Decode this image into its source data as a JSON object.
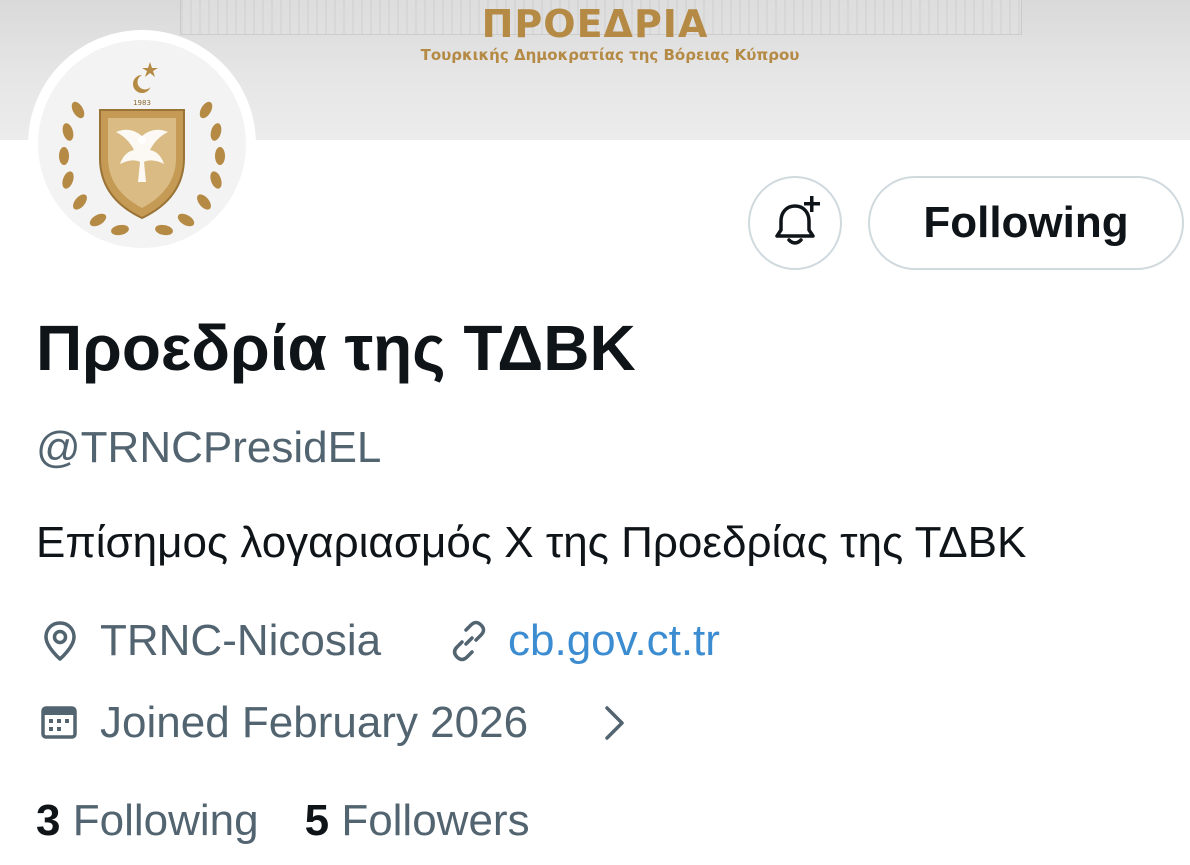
{
  "banner": {
    "title": "ΠΡΟΕΔΡΙΑ",
    "subtitle": "Τουρκικής Δημοκρατίας της Βόρειας Κύπρου"
  },
  "profile": {
    "display_name": "Προεδρία της ΤΔΒΚ",
    "handle": "@TRNCPresidEL",
    "bio": "Επίσημος λογαριασμός X της Προεδρίας της ΤΔΒΚ",
    "location": "TRNC-Nicosia",
    "website": "cb.gov.ct.tr",
    "joined": "Joined February 2026"
  },
  "actions": {
    "following_label": "Following",
    "notify_icon": "bell-plus-icon"
  },
  "stats": {
    "following_count": "3",
    "following_label": "Following",
    "followers_count": "5",
    "followers_label": "Followers"
  },
  "icons": {
    "location": "location-pin-icon",
    "link": "link-icon",
    "calendar": "calendar-icon",
    "chevron": "chevron-right-icon"
  },
  "colors": {
    "gold": "#b58a44",
    "text": "#0f1419",
    "muted": "#536471",
    "link": "#3b8cd1",
    "border": "#cfd9de"
  }
}
